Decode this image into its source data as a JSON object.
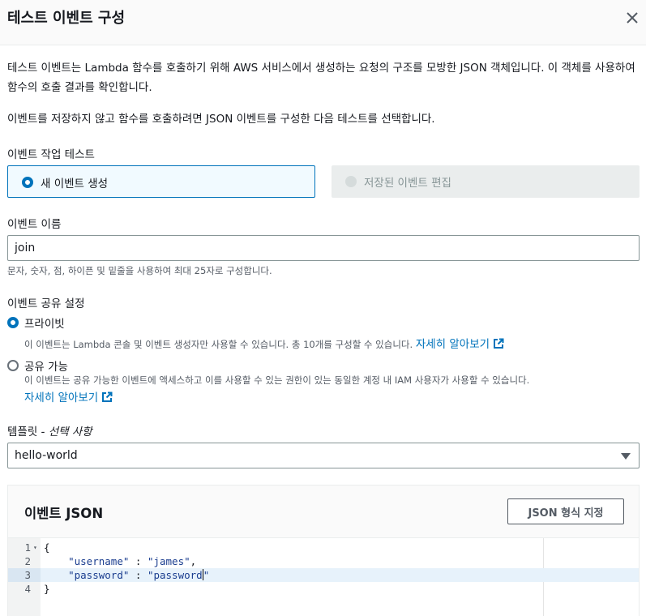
{
  "header": {
    "title": "테스트 이벤트 구성"
  },
  "description": {
    "line1": "테스트 이벤트는 Lambda 함수를 호출하기 위해 AWS 서비스에서 생성하는 요청의 구조를 모방한 JSON 객체입니다. 이 객체를 사용하여 함수의 호출 결과를 확인합니다.",
    "line2": "이벤트를 저장하지 않고 함수를 호출하려면 JSON 이벤트를 구성한 다음 테스트를 선택합니다."
  },
  "event_action": {
    "label": "이벤트 작업 테스트",
    "options": [
      {
        "label": "새 이벤트 생성",
        "selected": true
      },
      {
        "label": "저장된 이벤트 편집",
        "selected": false,
        "disabled": true
      }
    ]
  },
  "event_name": {
    "label": "이벤트 이름",
    "value": "join",
    "hint": "문자, 숫자, 점, 하이픈 및 밑줄을 사용하여 최대 25자로 구성합니다."
  },
  "sharing": {
    "label": "이벤트 공유 설정",
    "private": {
      "label": "프라이빗",
      "description": "이 이벤트는 Lambda 콘솔 및 이벤트 생성자만 사용할 수 있습니다. 총 10개를 구성할 수 있습니다.",
      "link": "자세히 알아보기",
      "selected": true
    },
    "shareable": {
      "label": "공유 가능",
      "description": "이 이벤트는 공유 가능한 이벤트에 액세스하고 이를 사용할 수 있는 권한이 있는 동일한 계정 내 IAM 사용자가 사용할 수 있습니다.",
      "link": "자세히 알아보기",
      "selected": false
    }
  },
  "template": {
    "label": "템플릿",
    "label_optional": " - 선택 사항",
    "value": "hello-world"
  },
  "event_json": {
    "title": "이벤트 JSON",
    "format_button": "JSON 형식 지정",
    "lines": [
      {
        "num": "1",
        "text": "{"
      },
      {
        "num": "2",
        "key": "\"username\"",
        "sep": " : ",
        "val": "\"james\"",
        "tail": ","
      },
      {
        "num": "3",
        "key": "\"password\"",
        "sep": " : ",
        "val": "\"password",
        "tail": "\""
      },
      {
        "num": "4",
        "text": "}"
      }
    ],
    "active_line": 3
  },
  "colors": {
    "accent": "#0073bb",
    "text": "#16191f",
    "muted": "#545b64"
  }
}
